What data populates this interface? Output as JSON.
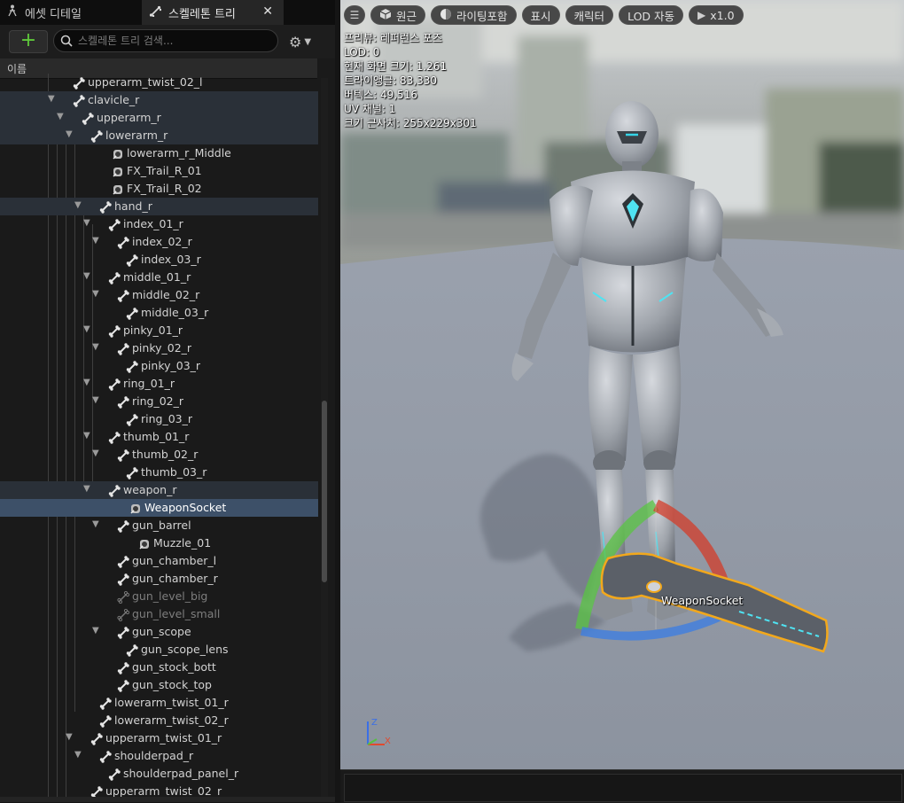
{
  "tabs": [
    {
      "label": "에셋 디테일",
      "icon": "asset-details-icon",
      "active": false
    },
    {
      "label": "스켈레톤 트리",
      "icon": "skeleton-tree-icon",
      "active": true
    }
  ],
  "toolbar": {
    "add_label": "+",
    "search_placeholder": "스켈레톤 트리 검색...",
    "settings_icon": "gear-icon"
  },
  "tree": {
    "column_header": "이름",
    "rows": [
      {
        "label": "upperarm_twist_02_l",
        "depth": 0,
        "type": "bone",
        "state": "normal"
      },
      {
        "label": "clavicle_r",
        "depth": 0,
        "type": "bone",
        "expanded": true,
        "state": "highlight"
      },
      {
        "label": "upperarm_r",
        "depth": 1,
        "type": "bone",
        "expanded": true,
        "state": "highlight"
      },
      {
        "label": "lowerarm_r",
        "depth": 2,
        "type": "bone",
        "expanded": true,
        "state": "highlight"
      },
      {
        "label": "lowerarm_r_Middle",
        "depth": 3,
        "type": "socket",
        "state": "normal"
      },
      {
        "label": "FX_Trail_R_01",
        "depth": 3,
        "type": "socket",
        "state": "normal"
      },
      {
        "label": "FX_Trail_R_02",
        "depth": 3,
        "type": "socket",
        "state": "normal"
      },
      {
        "label": "hand_r",
        "depth": 3,
        "type": "bone",
        "expanded": true,
        "state": "highlight"
      },
      {
        "label": "index_01_r",
        "depth": 4,
        "type": "bone",
        "expanded": true,
        "state": "normal"
      },
      {
        "label": "index_02_r",
        "depth": 5,
        "type": "bone",
        "expanded": true,
        "state": "normal"
      },
      {
        "label": "index_03_r",
        "depth": 6,
        "type": "bone",
        "state": "normal"
      },
      {
        "label": "middle_01_r",
        "depth": 4,
        "type": "bone",
        "expanded": true,
        "state": "normal"
      },
      {
        "label": "middle_02_r",
        "depth": 5,
        "type": "bone",
        "expanded": true,
        "state": "normal"
      },
      {
        "label": "middle_03_r",
        "depth": 6,
        "type": "bone",
        "state": "normal"
      },
      {
        "label": "pinky_01_r",
        "depth": 4,
        "type": "bone",
        "expanded": true,
        "state": "normal"
      },
      {
        "label": "pinky_02_r",
        "depth": 5,
        "type": "bone",
        "expanded": true,
        "state": "normal"
      },
      {
        "label": "pinky_03_r",
        "depth": 6,
        "type": "bone",
        "state": "normal"
      },
      {
        "label": "ring_01_r",
        "depth": 4,
        "type": "bone",
        "expanded": true,
        "state": "normal"
      },
      {
        "label": "ring_02_r",
        "depth": 5,
        "type": "bone",
        "expanded": true,
        "state": "normal"
      },
      {
        "label": "ring_03_r",
        "depth": 6,
        "type": "bone",
        "state": "normal"
      },
      {
        "label": "thumb_01_r",
        "depth": 4,
        "type": "bone",
        "expanded": true,
        "state": "normal"
      },
      {
        "label": "thumb_02_r",
        "depth": 5,
        "type": "bone",
        "expanded": true,
        "state": "normal"
      },
      {
        "label": "thumb_03_r",
        "depth": 6,
        "type": "bone",
        "state": "normal"
      },
      {
        "label": "weapon_r",
        "depth": 4,
        "type": "bone",
        "expanded": true,
        "state": "highlight"
      },
      {
        "label": "WeaponSocket",
        "depth": 5,
        "type": "socket",
        "state": "selected"
      },
      {
        "label": "gun_barrel",
        "depth": 5,
        "type": "bone",
        "expanded": true,
        "state": "normal"
      },
      {
        "label": "Muzzle_01",
        "depth": 6,
        "type": "socket",
        "state": "normal"
      },
      {
        "label": "gun_chamber_l",
        "depth": 5,
        "type": "bone",
        "state": "normal"
      },
      {
        "label": "gun_chamber_r",
        "depth": 5,
        "type": "bone",
        "state": "normal"
      },
      {
        "label": "gun_level_big",
        "depth": 5,
        "type": "bone-dim",
        "state": "dim"
      },
      {
        "label": "gun_level_small",
        "depth": 5,
        "type": "bone-dim",
        "state": "dim"
      },
      {
        "label": "gun_scope",
        "depth": 5,
        "type": "bone",
        "expanded": true,
        "state": "normal"
      },
      {
        "label": "gun_scope_lens",
        "depth": 6,
        "type": "bone",
        "state": "normal"
      },
      {
        "label": "gun_stock_bott",
        "depth": 5,
        "type": "bone",
        "state": "normal"
      },
      {
        "label": "gun_stock_top",
        "depth": 5,
        "type": "bone",
        "state": "normal"
      },
      {
        "label": "lowerarm_twist_01_r",
        "depth": 3,
        "type": "bone",
        "state": "normal"
      },
      {
        "label": "lowerarm_twist_02_r",
        "depth": 3,
        "type": "bone",
        "state": "normal"
      },
      {
        "label": "upperarm_twist_01_r",
        "depth": 2,
        "type": "bone",
        "expanded": true,
        "state": "normal"
      },
      {
        "label": "shoulderpad_r",
        "depth": 3,
        "type": "bone",
        "expanded": true,
        "state": "normal"
      },
      {
        "label": "shoulderpad_panel_r",
        "depth": 4,
        "type": "bone",
        "state": "normal"
      },
      {
        "label": "upperarm_twist_02_r",
        "depth": 2,
        "type": "bone",
        "state": "normal"
      }
    ]
  },
  "viewport": {
    "toolbar": {
      "menu_icon": "hamburger-icon",
      "perspective_label": "원근",
      "lighting_label": "라이팅포함",
      "show_label": "표시",
      "character_label": "캐릭터",
      "lod_label": "LOD 자동",
      "play_speed_label": "x1.0"
    },
    "stats": [
      "프리뷰: 레퍼런스 포즈",
      "LOD: 0",
      "현재 화면 크기: 1.261",
      "트라이앵글: 83,330",
      "버텍스: 49,516",
      "UV 채널: 1",
      "크기 근사치: 255x229x301"
    ],
    "socket_label": "WeaponSocket",
    "axis_labels": {
      "z": "Z",
      "x": "X"
    }
  }
}
